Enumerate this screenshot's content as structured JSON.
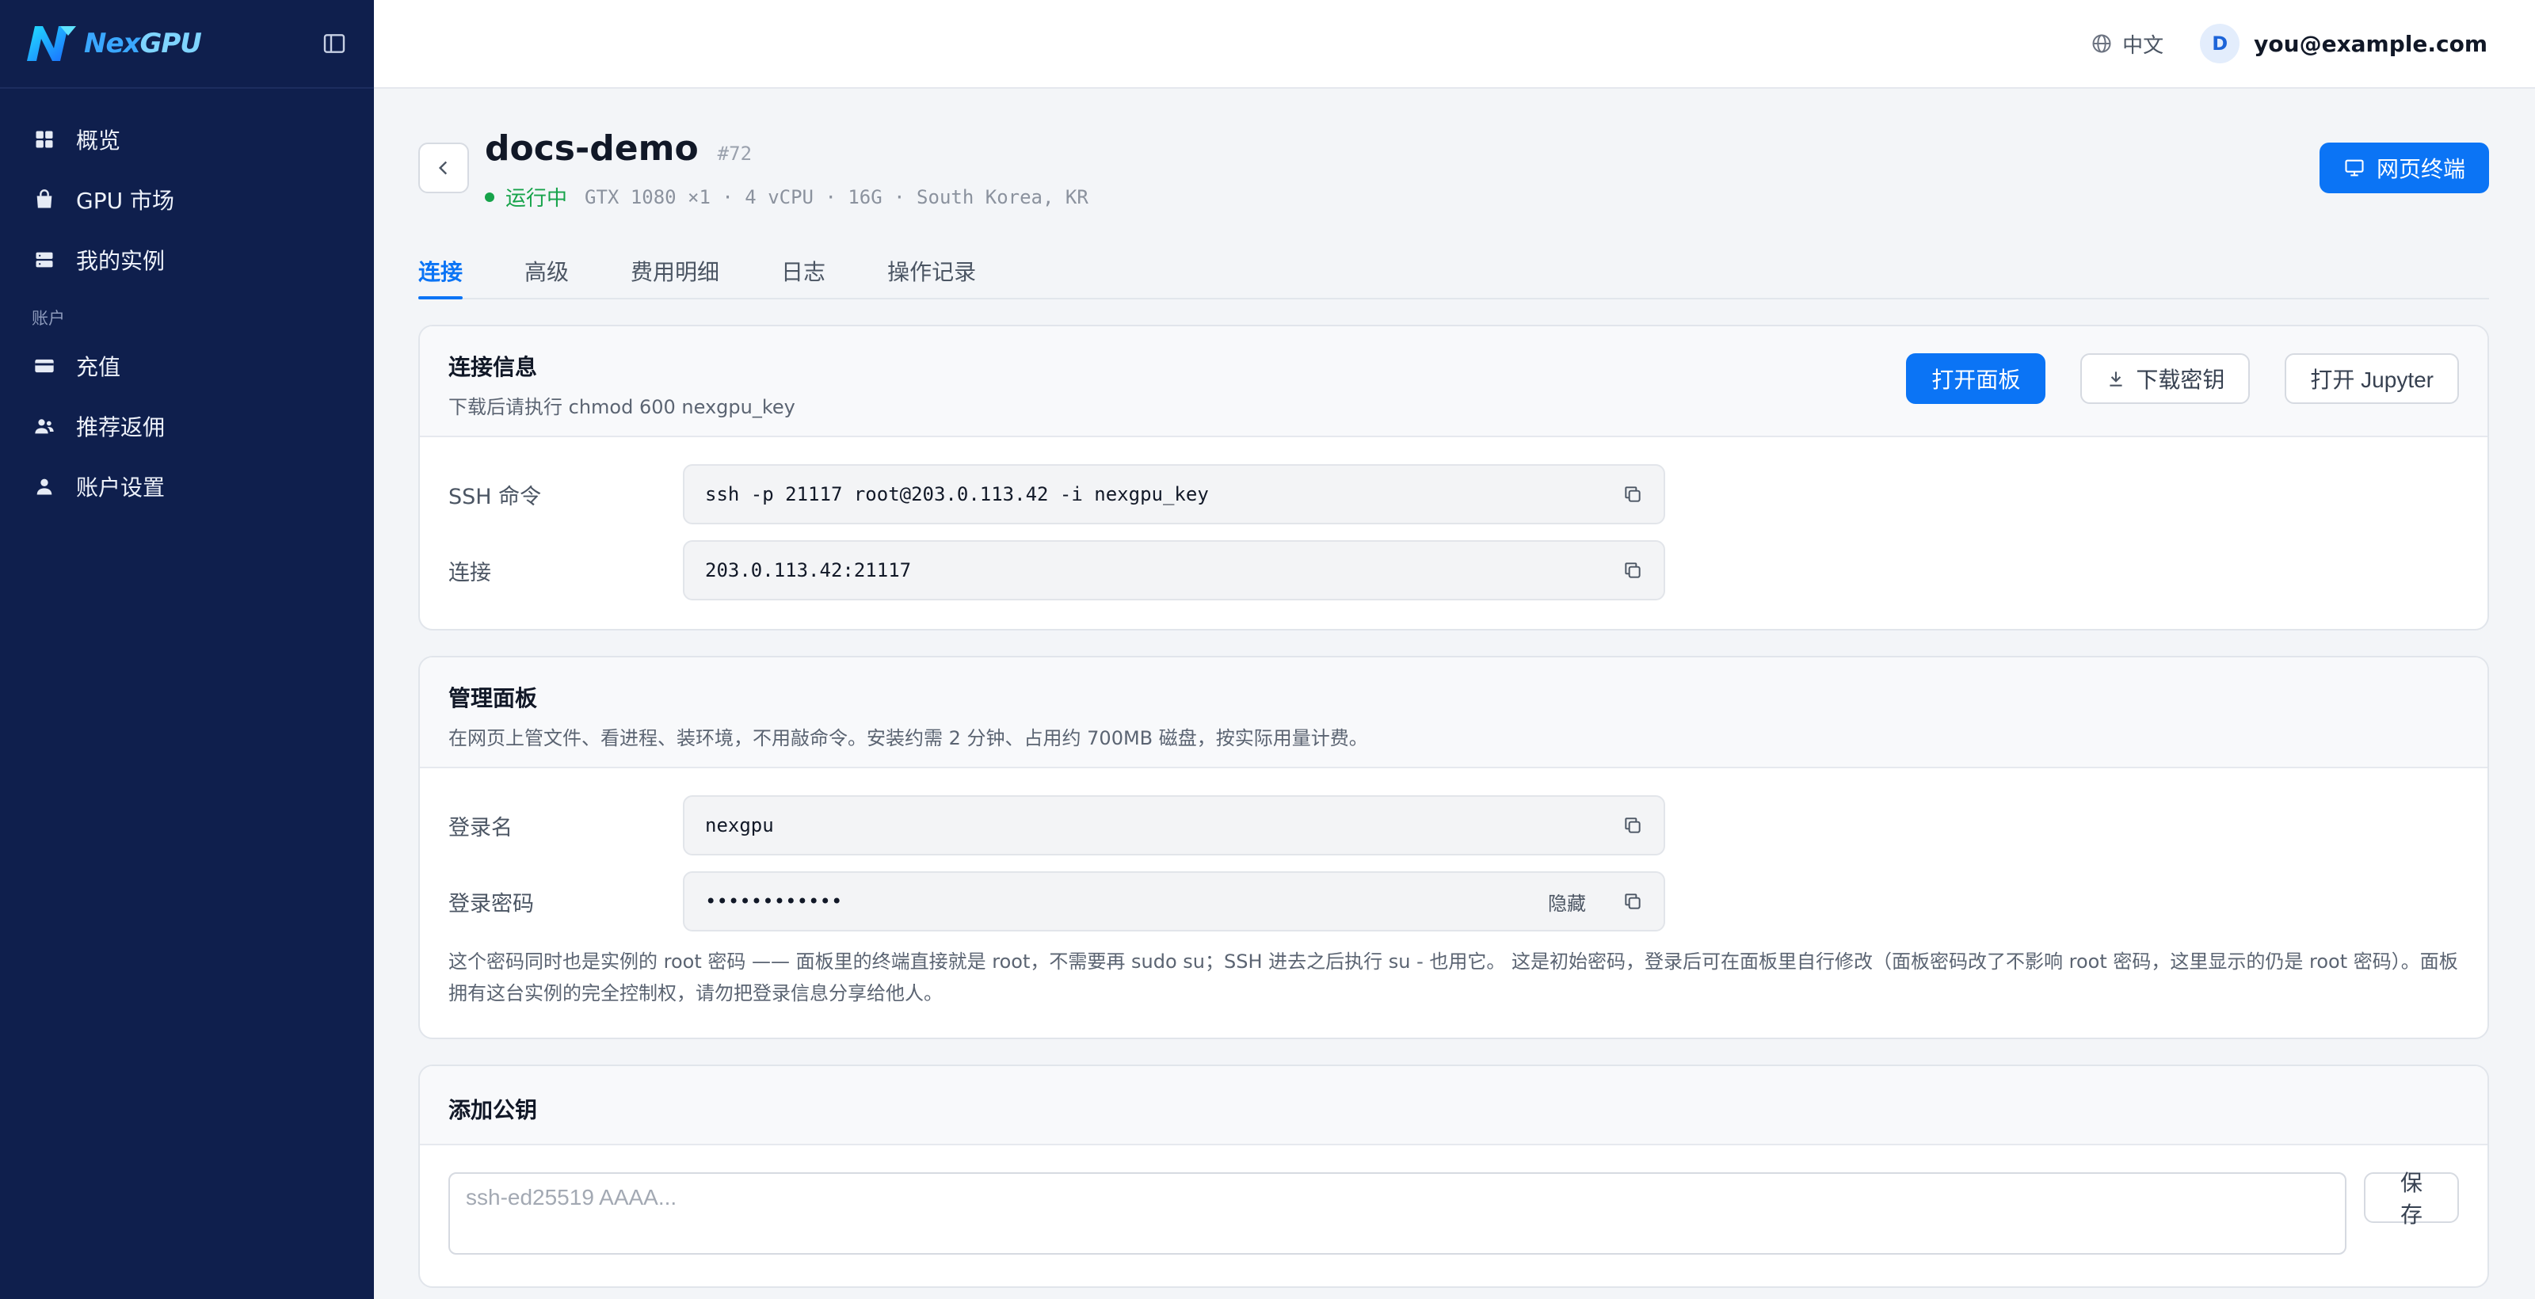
{
  "brand": {
    "logo_text_a": "Nex",
    "logo_text_b": "GPU"
  },
  "sidebar": {
    "items": [
      {
        "label": "概览",
        "icon": "dashboard-icon"
      },
      {
        "label": "GPU 市场",
        "icon": "shopping-bag-icon"
      },
      {
        "label": "我的实例",
        "icon": "server-icon"
      }
    ],
    "section_account": "账户",
    "account_items": [
      {
        "label": "充值",
        "icon": "credit-card-icon"
      },
      {
        "label": "推荐返佣",
        "icon": "users-icon"
      },
      {
        "label": "账户设置",
        "icon": "user-icon"
      }
    ]
  },
  "topbar": {
    "language": "中文",
    "avatar_initial": "D",
    "email": "you@example.com"
  },
  "instance": {
    "name": "docs-demo",
    "id": "#72",
    "status": "运行中",
    "specs": "GTX 1080 ×1 · 4 vCPU · 16G · South Korea, KR",
    "terminal_button": "网页终端"
  },
  "tabs": [
    "连接",
    "高级",
    "费用明细",
    "日志",
    "操作记录"
  ],
  "connection": {
    "title": "连接信息",
    "subtitle": "下载后请执行 chmod 600 nexgpu_key",
    "open_panel": "打开面板",
    "download_key": "下载密钥",
    "open_jupyter": "打开 Jupyter",
    "ssh_label": "SSH 命令",
    "ssh_value": "ssh -p 21117 root@203.0.113.42 -i nexgpu_key",
    "conn_label": "连接",
    "conn_value": "203.0.113.42:21117"
  },
  "panel": {
    "title": "管理面板",
    "subtitle": "在网页上管文件、看进程、装环境，不用敲命令。安装约需 2 分钟、占用约 700MB 磁盘，按实际用量计费。",
    "login_label": "登录名",
    "login_value": "nexgpu",
    "password_label": "登录密码",
    "password_value": "••••••••••••",
    "hide_label": "隐藏",
    "note": "这个密码同时也是实例的 root 密码 —— 面板里的终端直接就是 root，不需要再 sudo su；SSH 进去之后执行 su - 也用它。 这是初始密码，登录后可在面板里自行修改（面板密码改了不影响 root 密码，这里显示的仍是 root 密码）。面板拥有这台实例的完全控制权，请勿把登录信息分享给他人。"
  },
  "pubkey": {
    "title": "添加公钥",
    "placeholder": "ssh-ed25519 AAAA...",
    "save": "保存"
  },
  "colors": {
    "sidebar_bg": "#0f1f4d",
    "accent": "#0b74f5",
    "running": "#16a34a"
  }
}
